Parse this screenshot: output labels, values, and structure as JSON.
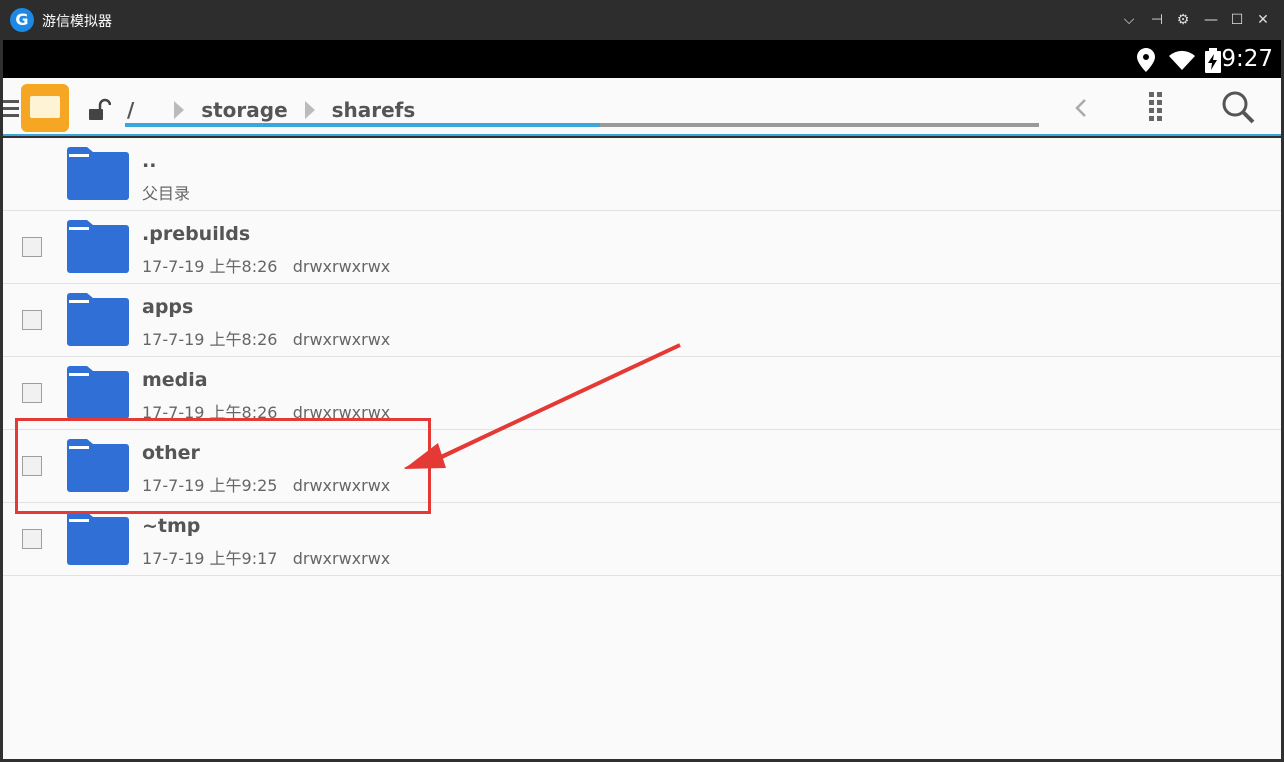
{
  "window": {
    "title": "游信模拟器",
    "logo_letter": "G",
    "controls": [
      "⌵",
      "⊣",
      "⚙",
      "—",
      "☐",
      "✕"
    ]
  },
  "status_bar": {
    "time": "9:27",
    "icons": [
      "location-icon",
      "wifi-icon",
      "battery-charging-icon"
    ]
  },
  "toolbar": {
    "breadcrumbs": [
      "/",
      "storage",
      "sharefs"
    ],
    "path_progress_fraction": 0.52,
    "icons": [
      "menu-icon",
      "file-manager-app-icon",
      "unlock-icon",
      "back-chevron-icon",
      "grid-view-icon",
      "search-icon"
    ]
  },
  "files": [
    {
      "name": "..",
      "meta": "父目录",
      "checkbox": false
    },
    {
      "name": ".prebuilds",
      "meta": "17-7-19 上午8:26   drwxrwxrwx",
      "checkbox": true
    },
    {
      "name": "apps",
      "meta": "17-7-19 上午8:26   drwxrwxrwx",
      "checkbox": true
    },
    {
      "name": "media",
      "meta": "17-7-19 上午8:26   drwxrwxrwx",
      "checkbox": true
    },
    {
      "name": "other",
      "meta": "17-7-19 上午9:25   drwxrwxrwx",
      "checkbox": true
    },
    {
      "name": "~tmp",
      "meta": "17-7-19 上午9:17   drwxrwxrwx",
      "checkbox": true
    }
  ],
  "annotation": {
    "color": "#e53935",
    "highlighted_item": "other"
  },
  "colors": {
    "accent": "#3aa6dc",
    "folder": "#2f6fd6",
    "app_icon": "#f5a623"
  }
}
